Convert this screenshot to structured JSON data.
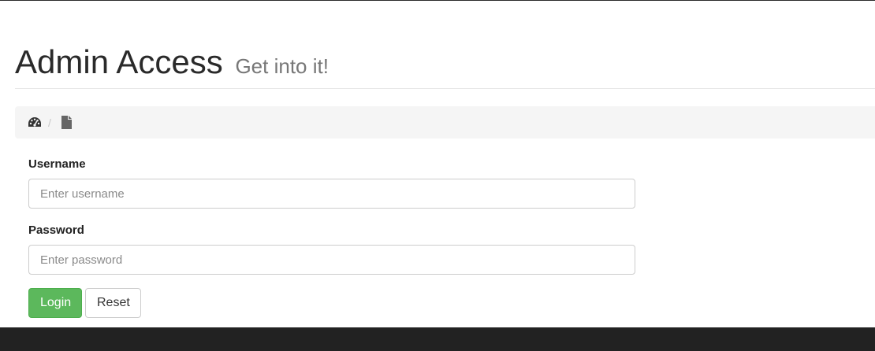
{
  "header": {
    "title": "Admin Access",
    "subtitle": "Get into it!"
  },
  "breadcrumb": {
    "separator": "/",
    "items": [
      {
        "icon": "dashboard-icon"
      },
      {
        "icon": "file-icon"
      }
    ]
  },
  "form": {
    "username_label": "Username",
    "username_placeholder": "Enter username",
    "username_value": "",
    "password_label": "Password",
    "password_placeholder": "Enter password",
    "password_value": "",
    "login_label": "Login",
    "reset_label": "Reset"
  },
  "colors": {
    "success": "#5cb85c",
    "footer": "#222222",
    "breadcrumb_bg": "#f5f5f5"
  }
}
